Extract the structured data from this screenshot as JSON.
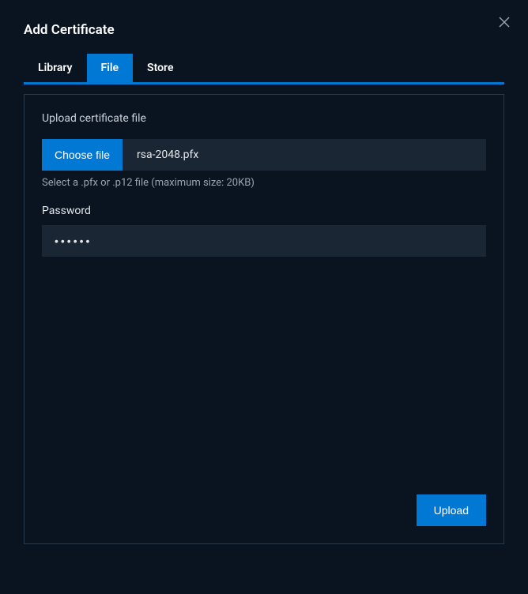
{
  "dialog": {
    "title": "Add Certificate"
  },
  "tabs": {
    "library": "Library",
    "file": "File",
    "store": "Store",
    "active": "file"
  },
  "upload": {
    "section_label": "Upload certificate file",
    "choose_button": "Choose file",
    "file_name": "rsa-2048.pfx",
    "hint": "Select a .pfx or .p12 file (maximum size: 20KB)",
    "password_label": "Password",
    "password_value": "••••••",
    "submit_button": "Upload"
  }
}
